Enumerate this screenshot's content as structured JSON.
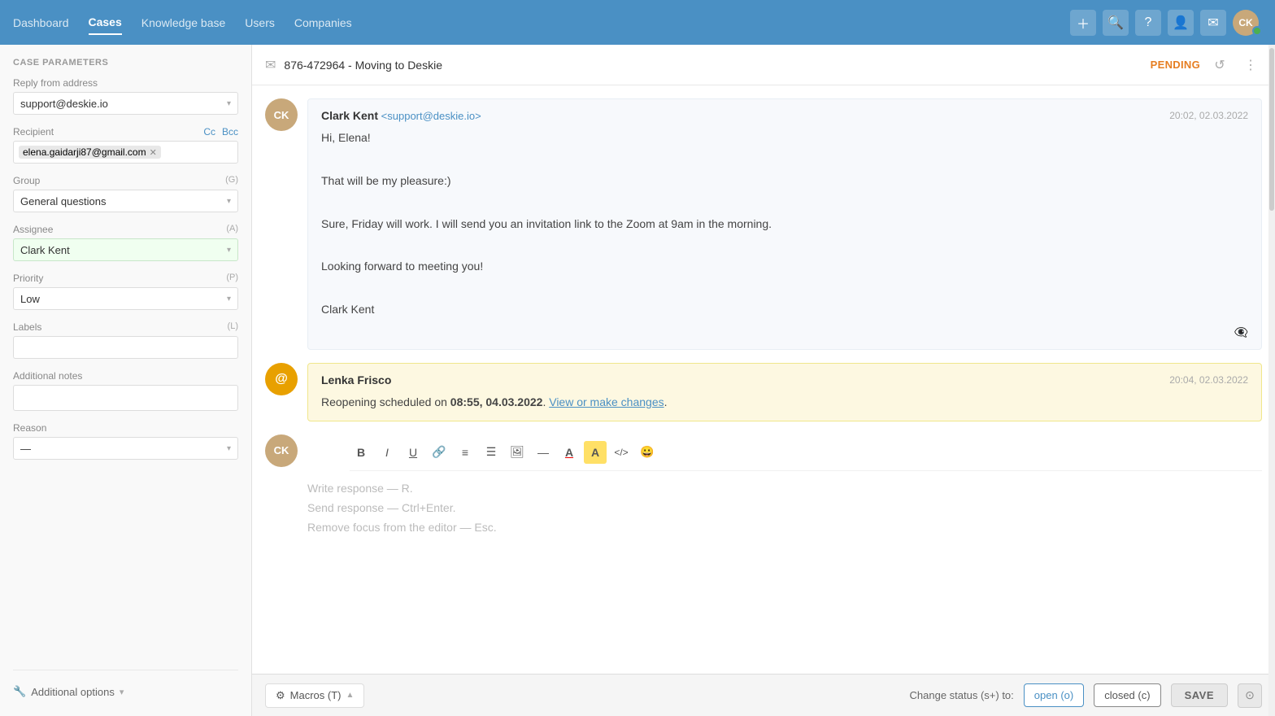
{
  "nav": {
    "items": [
      {
        "label": "Dashboard",
        "active": false
      },
      {
        "label": "Cases",
        "active": true
      },
      {
        "label": "Knowledge base",
        "active": false
      },
      {
        "label": "Users",
        "active": false
      },
      {
        "label": "Companies",
        "active": false
      }
    ],
    "icons": {
      "add": "+",
      "search": "🔍",
      "help": "?",
      "agent": "👤",
      "email": "✉"
    }
  },
  "sidebar": {
    "section_title": "CASE PARAMETERS",
    "reply_from": {
      "label": "Reply from address",
      "value": "support@deskie.io"
    },
    "recipient": {
      "label": "Recipient",
      "cc": "Cc",
      "bcc": "Bcc",
      "value": "elena.gaidarji87@gmail.com"
    },
    "group": {
      "label": "Group",
      "shortcut": "(G)",
      "value": "General questions"
    },
    "assignee": {
      "label": "Assignee",
      "shortcut": "(A)",
      "value": "Clark Kent"
    },
    "priority": {
      "label": "Priority",
      "shortcut": "(P)",
      "value": "Low"
    },
    "labels": {
      "label": "Labels",
      "shortcut": "(L)"
    },
    "additional_notes": {
      "label": "Additional notes"
    },
    "reason": {
      "label": "Reason",
      "value": "—"
    },
    "additional_options": "Additional options"
  },
  "case_header": {
    "case_id": "876-472964",
    "title": "Moving to Deskie",
    "status": "PENDING"
  },
  "messages": [
    {
      "sender_name": "Clark Kent",
      "sender_email": "<support@deskie.io>",
      "time": "20:02, 02.03.2022",
      "body_lines": [
        "Hi, Elena!",
        "",
        "That will be my pleasure:)",
        "",
        "Sure, Friday will work. I will send you an invitation link to the Zoom at 9am in the morning.",
        "",
        "Looking forward to meeting you!",
        "",
        "Clark Kent"
      ]
    }
  ],
  "notification": {
    "sender": "Lenka Frisco",
    "time": "20:04, 02.03.2022",
    "text_before": "Reopening scheduled on ",
    "highlight": "08:55, 04.03.2022",
    "text_mid": ". ",
    "link": "View or make changes",
    "text_after": "."
  },
  "editor": {
    "toolbar_buttons": [
      {
        "key": "bold",
        "label": "B"
      },
      {
        "key": "italic",
        "label": "I"
      },
      {
        "key": "underline",
        "label": "U"
      },
      {
        "key": "link",
        "label": "🔗"
      },
      {
        "key": "align",
        "label": "≡"
      },
      {
        "key": "list",
        "label": "☰"
      },
      {
        "key": "image",
        "label": "🖼"
      },
      {
        "key": "separator-line",
        "label": "—"
      },
      {
        "key": "font-color",
        "label": "A"
      },
      {
        "key": "font-bg",
        "label": "A"
      },
      {
        "key": "code",
        "label": "</>"
      },
      {
        "key": "emoji",
        "label": "😀"
      }
    ],
    "placeholder_lines": [
      "Write response — R.",
      "Send response — Ctrl+Enter.",
      "Remove focus from the editor — Esc."
    ]
  },
  "bottom_bar": {
    "macros_icon": "⚙",
    "macros_label": "Macros (T)",
    "change_status_label": "Change status (s+) to:",
    "open_label": "open (o)",
    "closed_label": "closed (c)",
    "save_label": "SAVE"
  }
}
